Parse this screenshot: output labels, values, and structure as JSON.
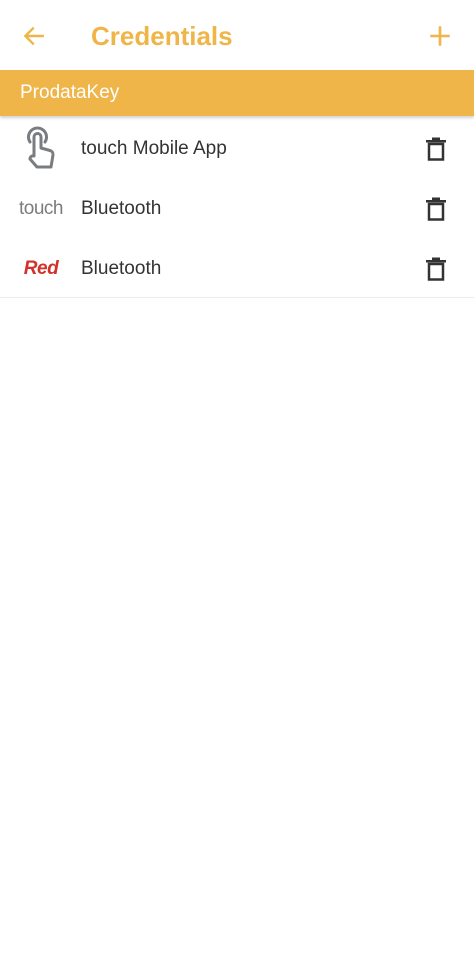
{
  "header": {
    "title": "Credentials",
    "back_icon": "arrow-left-icon",
    "add_icon": "plus-icon"
  },
  "section": {
    "title": "ProdataKey"
  },
  "credentials": [
    {
      "icon": "touch-hand-icon",
      "label": "touch Mobile App"
    },
    {
      "icon": "touch-logo-icon",
      "logo_text": "touch",
      "label": "Bluetooth"
    },
    {
      "icon": "red-logo-icon",
      "logo_text": "Red",
      "label": "Bluetooth"
    }
  ],
  "delete_icon": "trash-icon",
  "colors": {
    "accent": "#efb548",
    "header_text": "#efb548",
    "section_bg": "#efb548",
    "icon_gray": "#7a7d80",
    "trash": "#333333",
    "red_logo": "#d1322b"
  }
}
